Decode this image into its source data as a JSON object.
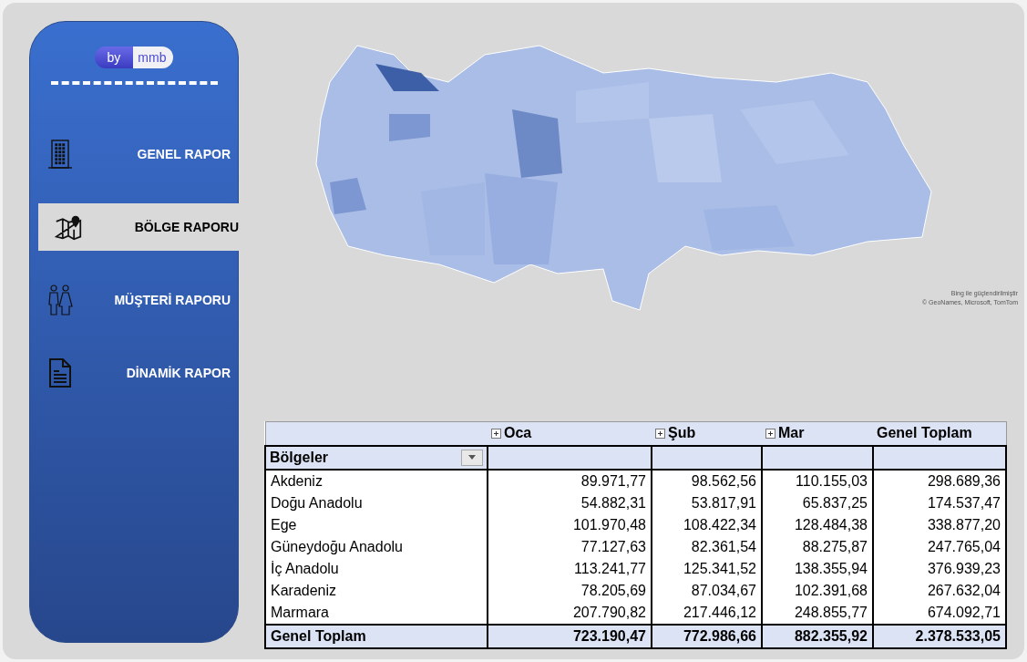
{
  "logo": {
    "left": "by",
    "right": "mmb"
  },
  "nav": [
    {
      "label": "GENEL RAPOR",
      "kind": "building",
      "selected": false
    },
    {
      "label": "BÖLGE RAPORU",
      "kind": "map",
      "selected": true
    },
    {
      "label": "MÜŞTERİ RAPORU",
      "kind": "people",
      "selected": false
    },
    {
      "label": "DİNAMİK RAPOR",
      "kind": "document",
      "selected": false
    }
  ],
  "map": {
    "attribution": [
      "Bing ile güçlendirilmiştir",
      "© GeoNames, Microsoft, TomTom"
    ]
  },
  "table": {
    "columns": [
      "Oca",
      "Şub",
      "Mar",
      "Genel Toplam"
    ],
    "row_header": "Bölgeler",
    "rows": [
      {
        "name": "Akdeniz",
        "values": [
          "89.971,77",
          "98.562,56",
          "110.155,03",
          "298.689,36"
        ]
      },
      {
        "name": "Doğu Anadolu",
        "values": [
          "54.882,31",
          "53.817,91",
          "65.837,25",
          "174.537,47"
        ]
      },
      {
        "name": "Ege",
        "values": [
          "101.970,48",
          "108.422,34",
          "128.484,38",
          "338.877,20"
        ]
      },
      {
        "name": "Güneydoğu Anadolu",
        "values": [
          "77.127,63",
          "82.361,54",
          "88.275,87",
          "247.765,04"
        ]
      },
      {
        "name": "İç Anadolu",
        "values": [
          "113.241,77",
          "125.341,52",
          "138.355,94",
          "376.939,23"
        ]
      },
      {
        "name": "Karadeniz",
        "values": [
          "78.205,69",
          "87.034,67",
          "102.391,68",
          "267.632,04"
        ]
      },
      {
        "name": "Marmara",
        "values": [
          "207.790,82",
          "217.446,12",
          "248.855,77",
          "674.092,71"
        ]
      }
    ],
    "total": {
      "name": "Genel Toplam",
      "values": [
        "723.190,47",
        "772.986,66",
        "882.355,92",
        "2.378.533,05"
      ]
    }
  }
}
